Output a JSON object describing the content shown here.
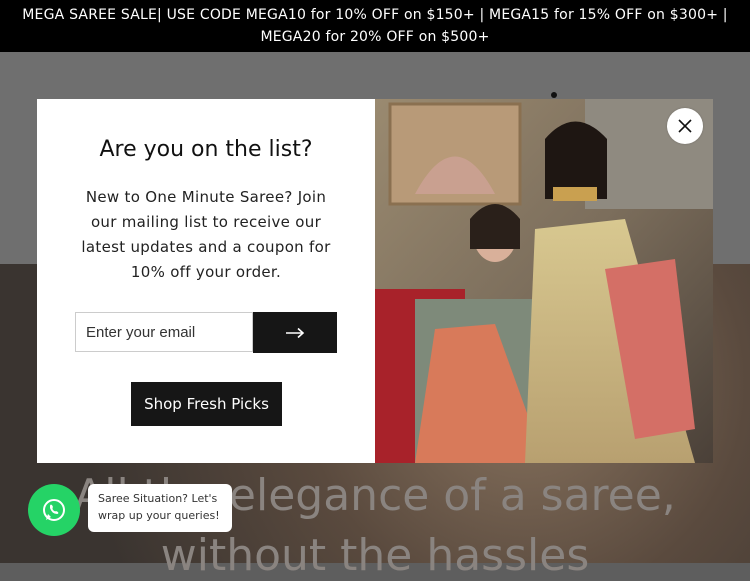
{
  "announcement": {
    "line1": "MEGA SAREE SALE| USE CODE MEGA10 for 10% OFF on $150+ | MEGA15 for 15% OFF on $300+ |",
    "line2": "MEGA20 for 20% OFF on $500+"
  },
  "hero": {
    "line1": "All the elegance of a saree,",
    "line2": "without the hassles"
  },
  "modal": {
    "title": "Are you on the list?",
    "description": "New to One Minute Saree? Join our mailing list to receive our latest updates and a coupon for 10% off your order.",
    "email_placeholder": "Enter your email",
    "submit_icon": "arrow-right-icon",
    "shop_button": "Shop Fresh Picks",
    "close_icon": "close-icon",
    "image": "two-women-in-silk-sarees"
  },
  "chat": {
    "icon": "whatsapp-icon",
    "bubble_text": "Saree Situation? Let's wrap up your queries!",
    "color": "#25d366"
  },
  "colors": {
    "announcement_bg": "#000000",
    "button_bg": "#161616"
  }
}
